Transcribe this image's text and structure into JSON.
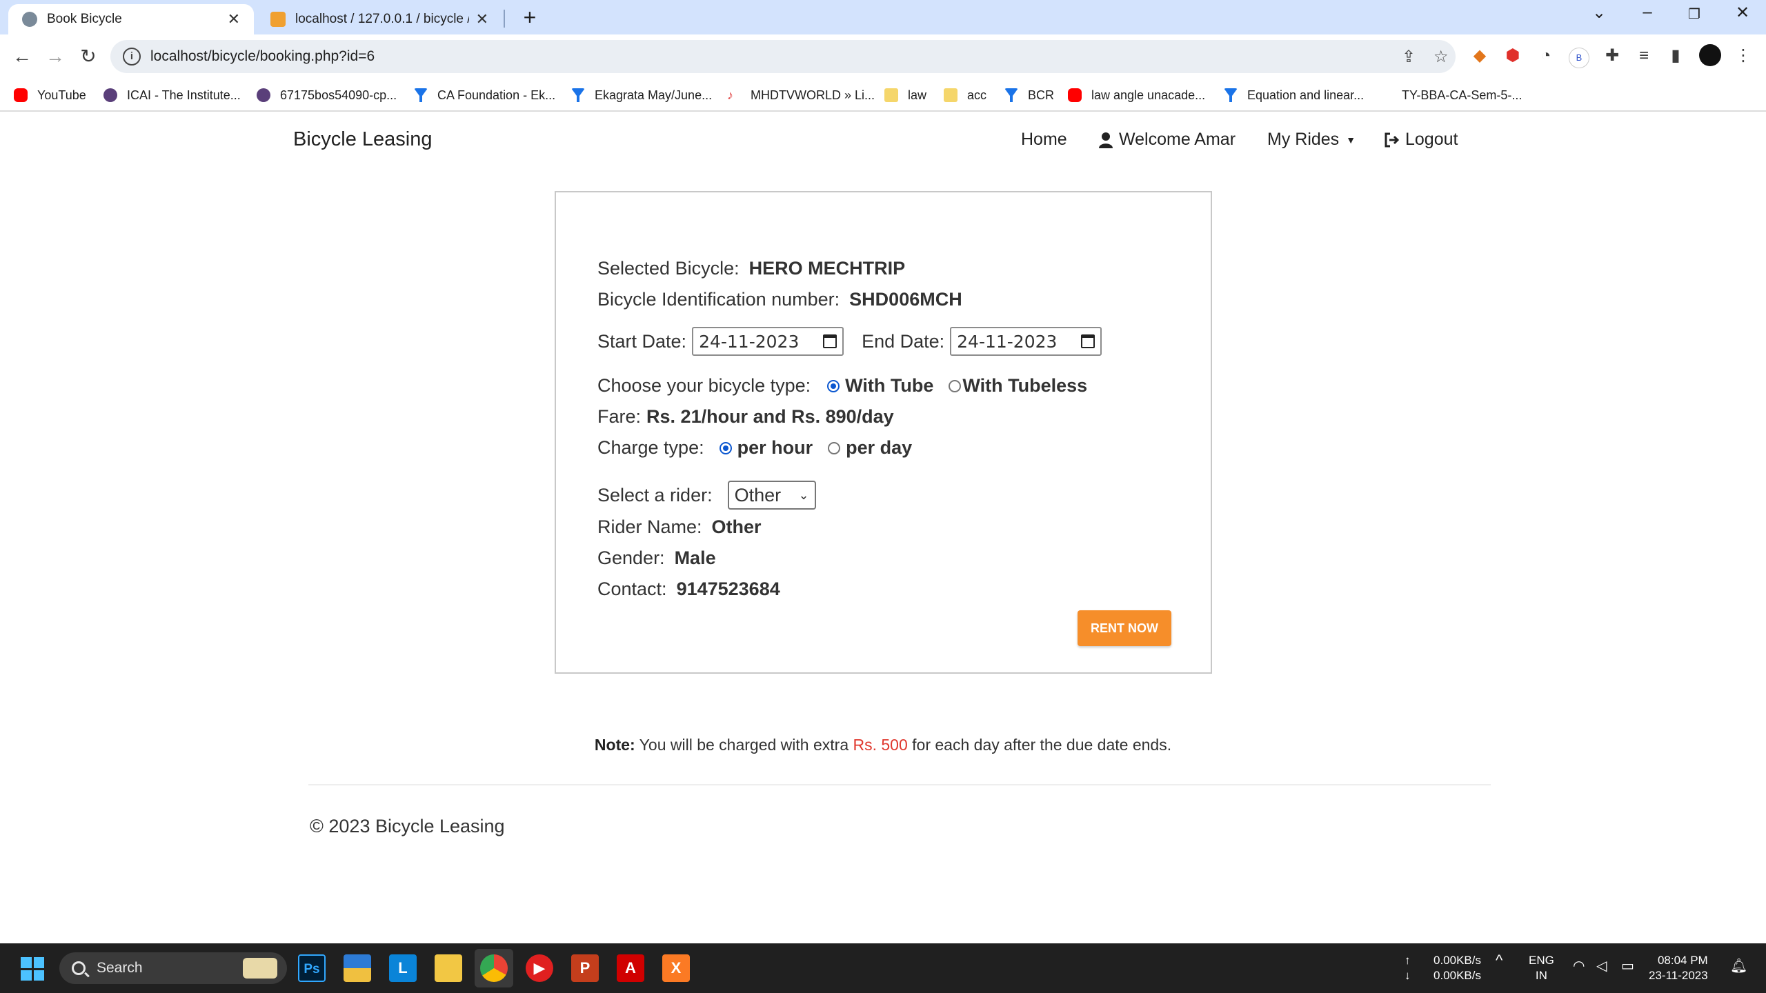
{
  "browser": {
    "tabs": [
      {
        "title": "Book Bicycle",
        "active": true
      },
      {
        "title": "localhost / 127.0.0.1 / bicycle / c",
        "active": false
      }
    ],
    "url": "localhost/bicycle/booking.php?id=6",
    "bookmarks": [
      {
        "label": "YouTube",
        "icon": "youtube-icon",
        "color": "#ff0000"
      },
      {
        "label": "ICAI - The Institute...",
        "icon": "icai-icon",
        "color": "#5a3f7a"
      },
      {
        "label": "67175bos54090-cp...",
        "icon": "icai-icon",
        "color": "#5a3f7a"
      },
      {
        "label": "CA Foundation - Ek...",
        "icon": "filter-icon",
        "color": "#1a73e8"
      },
      {
        "label": "Ekagrata May/June...",
        "icon": "filter-icon",
        "color": "#1a73e8"
      },
      {
        "label": "MHDTVWORLD » Li...",
        "icon": "mhdtv-icon",
        "color": "#e04040"
      },
      {
        "label": "law",
        "icon": "folder-icon",
        "color": "#f5d66b"
      },
      {
        "label": "acc",
        "icon": "folder-icon",
        "color": "#f5d66b"
      },
      {
        "label": "BCR",
        "icon": "filter-icon",
        "color": "#1a73e8"
      },
      {
        "label": "law angle unacade...",
        "icon": "youtube-icon",
        "color": "#ff0000"
      },
      {
        "label": "Equation and linear...",
        "icon": "filter-icon",
        "color": "#1a73e8"
      },
      {
        "label": "TY-BBA-CA-Sem-5-...",
        "icon": "",
        "color": ""
      }
    ]
  },
  "site": {
    "brand": "Bicycle Leasing",
    "nav": {
      "home": "Home",
      "welcome": "Welcome Amar",
      "rides": "My Rides",
      "logout": "Logout"
    }
  },
  "booking": {
    "selected_label": "Selected Bicycle:",
    "selected_value": "HERO MECHTRIP",
    "bin_label": "Bicycle Identification number:",
    "bin_value": "SHD006MCH",
    "start_label": "Start Date:",
    "start_value": "24-11-2023",
    "end_label": "End Date:",
    "end_value": "24-11-2023",
    "type_label": "Choose your bicycle type:",
    "type_options": [
      "With Tube",
      "With Tubeless"
    ],
    "fare_label": "Fare:",
    "fare_value": "Rs. 21/hour and Rs. 890/day",
    "charge_label": "Charge type:",
    "charge_options": [
      "per hour",
      "per day"
    ],
    "rider_label": "Select a rider:",
    "rider_select": "Other",
    "rider_name_label": "Rider Name:",
    "rider_name_value": "Other",
    "gender_label": "Gender:",
    "gender_value": "Male",
    "contact_label": "Contact:",
    "contact_value": "9147523684",
    "rent_button": "RENT NOW",
    "accent_color": "#f68e2a"
  },
  "note": {
    "label": "Note:",
    "text_before": "You will be charged with extra",
    "amount": "Rs. 500",
    "text_after": "for each day after the due date ends."
  },
  "footer": "© 2023 Bicycle Leasing",
  "taskbar": {
    "search_placeholder": "Search",
    "net_up": "0.00KB/s",
    "net_down": "0.00KB/s",
    "lang_top": "ENG",
    "lang_bottom": "IN",
    "time": "08:04 PM",
    "date": "23-11-2023"
  }
}
